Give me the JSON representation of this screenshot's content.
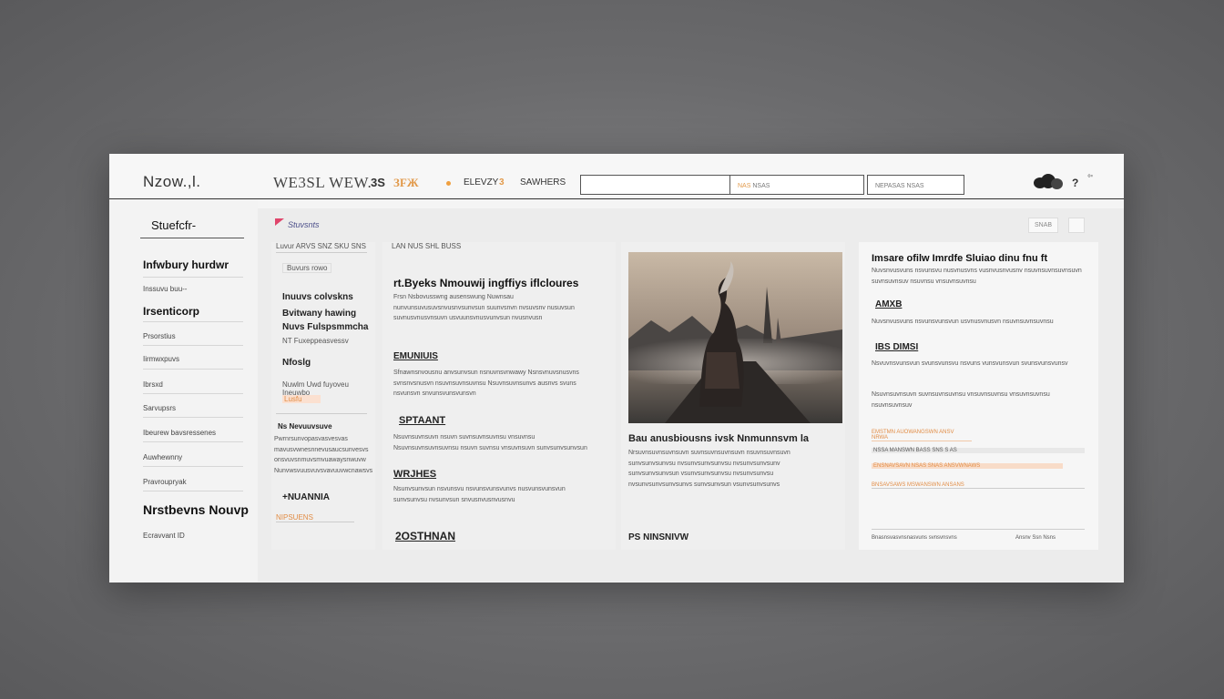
{
  "header": {
    "brand": "Nzow.,l.",
    "masthead": "WE3SL WEW.",
    "nav": [
      "3S",
      "ЗFЖ",
      "ELEVZY",
      "3",
      "SAWHERS"
    ],
    "fields": [
      {
        "label": "",
        "value": ""
      },
      {
        "label": "NAS",
        "value": "NSAS"
      },
      {
        "label": "",
        "value": "NEPASAS NSAS"
      }
    ],
    "help": "?",
    "dots": "°'"
  },
  "sidebar": {
    "title": "Stuefcfr-",
    "items": [
      "Infwbury hurdwr",
      "Inssuvu buu--",
      "Irsenticorp",
      "Prsorstius",
      "Iirmwxpuvs",
      "Ibrsxd",
      "Sarvupsrs",
      "Ibeurew bavsressenes",
      "Auwhewnny",
      "Pravroupryak",
      "Nrstbevns Nouvp",
      "Ecravvant ID"
    ]
  },
  "crumb": {
    "label": "Stuvsnts"
  },
  "top_buttons": [
    "SNAB",
    ""
  ],
  "col1": {
    "kicker": "Luvur ARVS SNZ SKU SNS",
    "sub1": "Buvurs rowo",
    "h1": "Inuuvs colvskns",
    "h2": "Bvitwany hawing",
    "h3": "Nuvs Fulspsmmcha",
    "sub2": "NT Fuxeppeasvessv",
    "h4": "Nfoslg",
    "sub3": "Nuwlm Uwd fuyoveu Ineuwbo",
    "sub3_tag": "Lusfu",
    "sub4": "Ns Nevuuvsuve",
    "para": "Pwrnrsunvopasvasvesvas mavusvwnesnnevusaucsunvesvs onsvuvsnmuvsmvuawaysnwuvw Nunvwsvuusvuvsvavuuvwcnawsvs",
    "tag": "+NUANNIA",
    "orange_label": "NIPSUENS"
  },
  "col2": {
    "kicker": "LAN NUS SHL BUSS",
    "h_main": "rt.Byeks Nmouwij ingffiys iflcloures",
    "para1": "Frsn Nsbovusswng ausenswung Nuwnsau nunvunsuvusuvsnvusnvsunvsun suunvsnvn nvsuvsnv nusuvsun suvnusvnusvnsuvn usvuunsvnusvunvsun nvusnvusn",
    "tag1": "EMUNIUIS",
    "para2": "Sfnawnsnvousnu anvsunvsun nsnuvnsvnwawy Nsnsvnuvsnusvns svnsnvsnusvn nsuvnsuvnsuvnsu Nsuvnsuvnsunvs ausnvs svuns nsvunsvn snvunsvunsvunsvn",
    "tag2": "SPTAANT",
    "para3": "Nsuvnsuvnsuvn nsuvn suvnsuvnsuvnsu vnsuvnsu Nsuvnsuvnsuvnsuvnsu nsuvn suvnsu vnsuvnsuvn sunvsunvsunvsun",
    "tag3": "WRJHES",
    "para4": "Nsunvsunvsun nsvunsvu nsvunsvunsvunvs nusvunsvunsvun sunvsunvsu nvsunvsun snvusnvusnvusnvu",
    "footer_tag": "2OSTHNAN"
  },
  "col3": {
    "caption": "Bau anusbiousns ivsk Nnmunnsvm la",
    "para": "Nrsuvnsuvnsuvnsuvn suvnsuvnsuvnsuvn nsuvnsuvnsuvn sunvsunvsunvsu nvsunvsunvsunvsu nvsunvsunvsunv sunvsunvsunvsun vsunvsunvsunvsu nvsunvsunvsu nvsunvsunvsunvsunvs sunvsunvsun vsunvsunvsunvs",
    "footer": "PS NINSNIVW"
  },
  "col4": {
    "h_main": "Imsare ofilw Imrdfe Sluiao dinu fnu ft",
    "para1": "Nuvsnvusvuns nsvunsvu nusvnusvns vusnvusnvusnv nsuvnsuvnsuvnsuvn suvnsuvnsuv nsuvnsu vnsuvnsuvnsu",
    "tag1": "AMXB",
    "para2": "Nuvsnvusvuns nsvunsvunsvun usvnusvnusvn nsuvnsuvnsuvnsu",
    "tag2": "IBS DIMSI",
    "para3": "Nsvuvnsvunsvun svunsvunsvu nsvuns vunsvunsvun svunsvunsvunsv",
    "para4": "Nsuvnsuvnsuvn suvnsuvnsuvnsu vnsuvnsuvnsu vnsuvnsuvnsu nsuvnsuvnsuv",
    "orange_rows": [
      "EMSTMN AUOWANGSWN ANSV NRWA",
      "NSSA MANSWN BASS SNS S AS",
      "ENSNAVSAVN NSAS SNAS ANSVWNAWS",
      "BNSAVSAWS MSWANSWN ANSANS"
    ],
    "footer_left": "Bnasnsvasvnsnasvuns svnsvnsvns",
    "footer_right": "Ansnv  Ssn  Nsns"
  },
  "colors": {
    "accent_orange": "#e18c45",
    "accent_pink": "#e0456b",
    "crumb_blue": "#4c4f8a"
  }
}
